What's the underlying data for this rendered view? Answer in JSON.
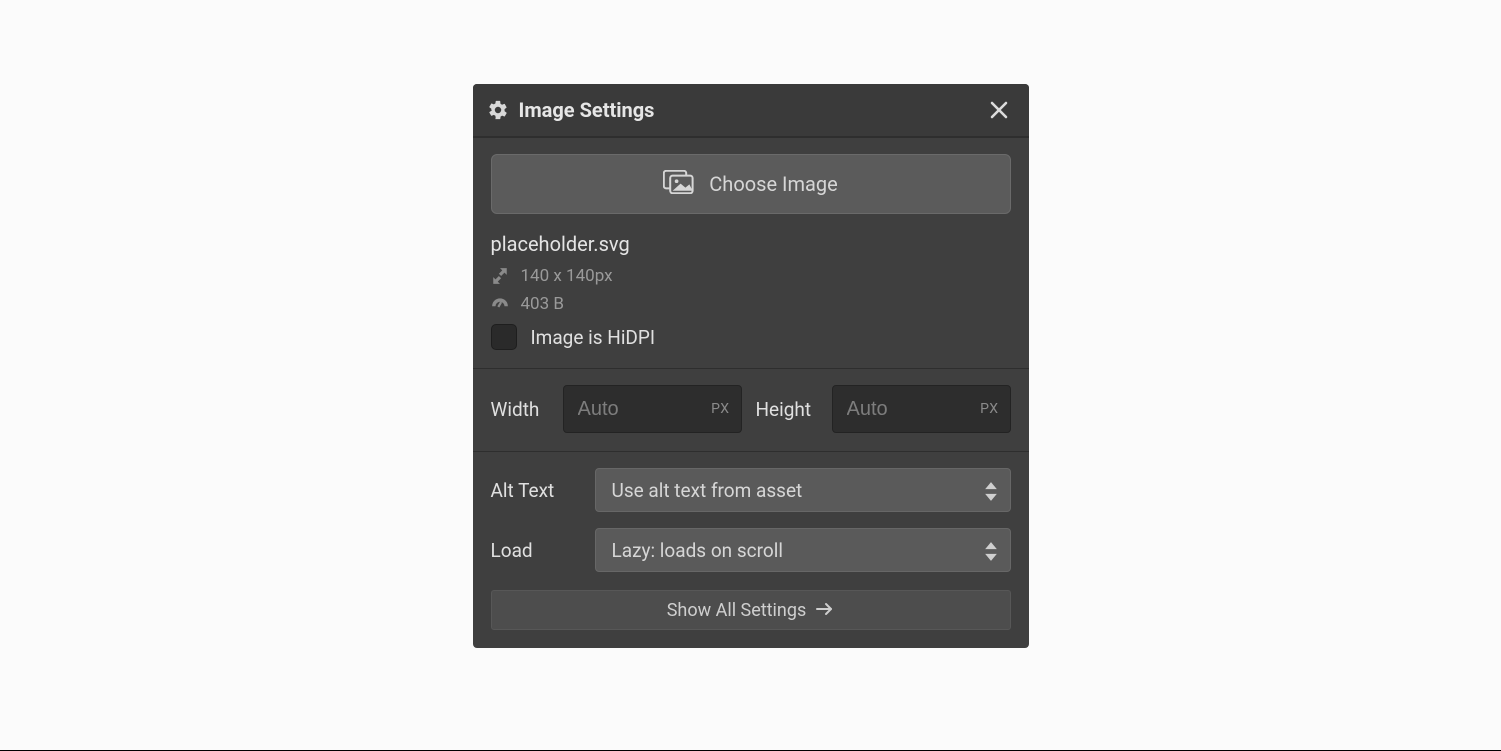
{
  "header": {
    "title": "Image Settings"
  },
  "choose": {
    "button_label": "Choose Image"
  },
  "file": {
    "name": "placeholder.svg",
    "dimensions": "140 x 140px",
    "size": "403 B",
    "hidpi_label": "Image is HiDPI",
    "hidpi_checked": false
  },
  "dims": {
    "width_label": "Width",
    "width_placeholder": "Auto",
    "width_unit": "PX",
    "height_label": "Height",
    "height_placeholder": "Auto",
    "height_unit": "PX"
  },
  "alt": {
    "label": "Alt Text",
    "value": "Use alt text from asset"
  },
  "load": {
    "label": "Load",
    "value": "Lazy: loads on scroll"
  },
  "footer": {
    "show_all_label": "Show All Settings"
  }
}
